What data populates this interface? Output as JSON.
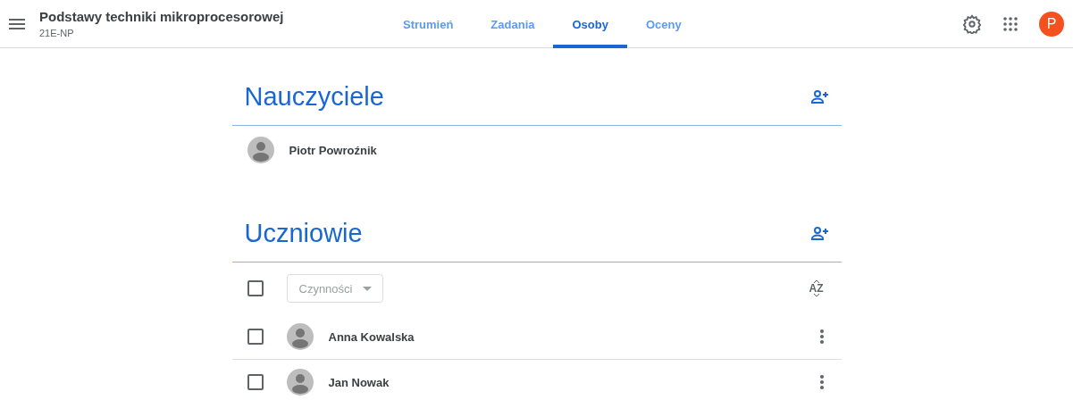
{
  "header": {
    "title": "Podstawy techniki mikroprocesorowej",
    "subtitle": "21E-NP",
    "avatar_letter": "P"
  },
  "tabs": [
    {
      "label": "Strumień",
      "selected": false
    },
    {
      "label": "Zadania",
      "selected": false
    },
    {
      "label": "Osoby",
      "selected": true
    },
    {
      "label": "Oceny",
      "selected": false
    }
  ],
  "teachers": {
    "heading": "Nauczyciele",
    "people": [
      {
        "name": "Piotr Powroźnik"
      }
    ]
  },
  "students": {
    "heading": "Uczniowie",
    "select_all": {
      "checked": false
    },
    "actions": {
      "label": "Czynności",
      "disabled": true
    },
    "sort_label": "AZ",
    "people": [
      {
        "name": "Anna Kowalska",
        "checked": false
      },
      {
        "name": "Jan Nowak",
        "checked": false
      }
    ]
  }
}
